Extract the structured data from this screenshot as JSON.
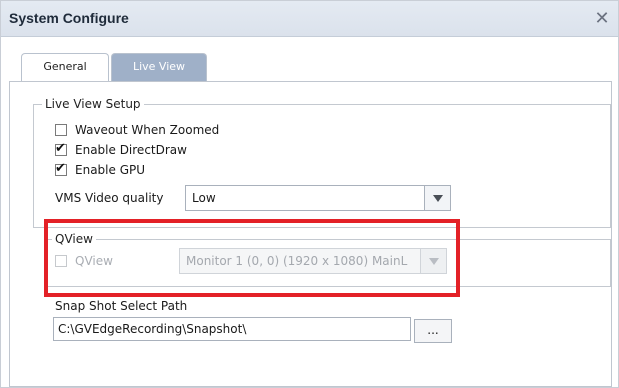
{
  "window": {
    "title": "System Configure",
    "close_glyph": "✕"
  },
  "tabs": [
    {
      "label": "General",
      "active": false
    },
    {
      "label": "Live View",
      "active": true
    }
  ],
  "live_view_setup": {
    "legend": "Live View Setup",
    "options": [
      {
        "label": "Waveout When Zoomed",
        "checked": false
      },
      {
        "label": "Enable DirectDraw",
        "checked": true
      },
      {
        "label": "Enable GPU",
        "checked": true
      }
    ],
    "vms_quality": {
      "label": "VMS Video quality",
      "value": "Low"
    }
  },
  "qview": {
    "legend": "QView",
    "checkbox_label": "QView",
    "checked": false,
    "enabled": false,
    "monitor_value": "Monitor 1   (0, 0) (1920 x 1080) MainL"
  },
  "snapshot": {
    "label": "Snap Shot Select Path",
    "path": "C:\\GVEdgeRecording\\Snapshot\\",
    "browse_label": "..."
  },
  "highlight_color": "#e32127",
  "tab_active_color": "#9fb0c8"
}
